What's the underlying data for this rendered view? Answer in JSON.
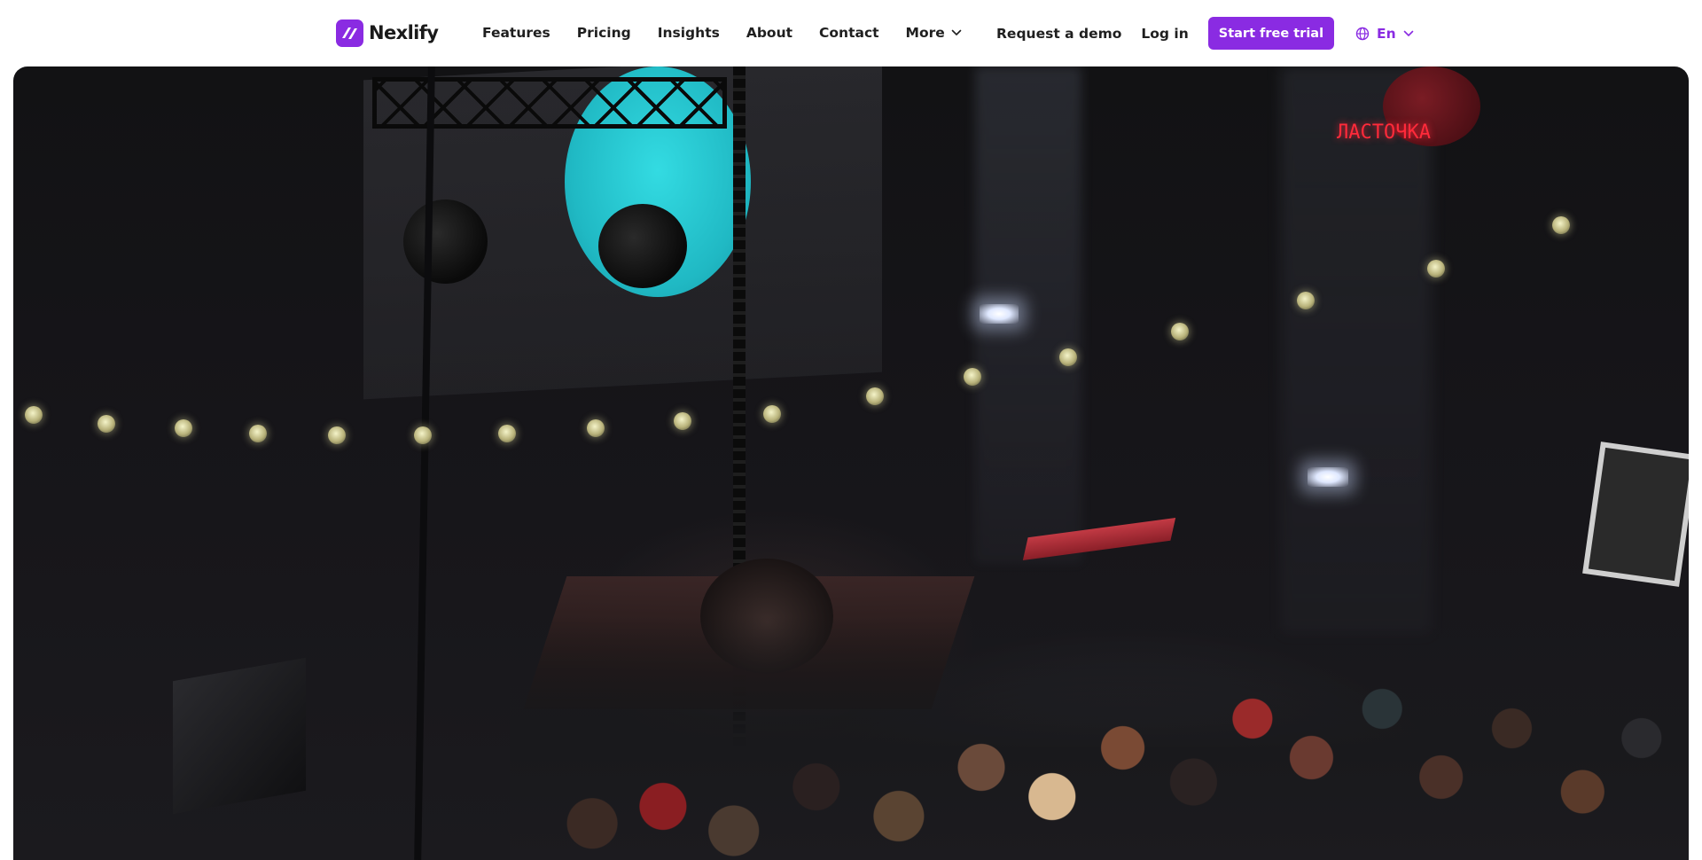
{
  "brand": {
    "name": "Nexlify",
    "accent": "#8a2be2",
    "icon": "nexlify-logo-icon"
  },
  "nav": {
    "items": [
      {
        "label": "Features"
      },
      {
        "label": "Pricing"
      },
      {
        "label": "Insights"
      },
      {
        "label": "About"
      },
      {
        "label": "Contact"
      },
      {
        "label": "More",
        "icon": "chevron-down-icon"
      }
    ]
  },
  "actions": {
    "demo_label": "Request a demo",
    "login_label": "Log in",
    "cta_label": "Start free trial",
    "language": {
      "label": "En",
      "icon": "globe-icon",
      "dropdown_icon": "chevron-down-icon"
    }
  },
  "hero": {
    "image": "concert-venue-photo",
    "neon_sign": "ЛАСТОЧКА"
  }
}
